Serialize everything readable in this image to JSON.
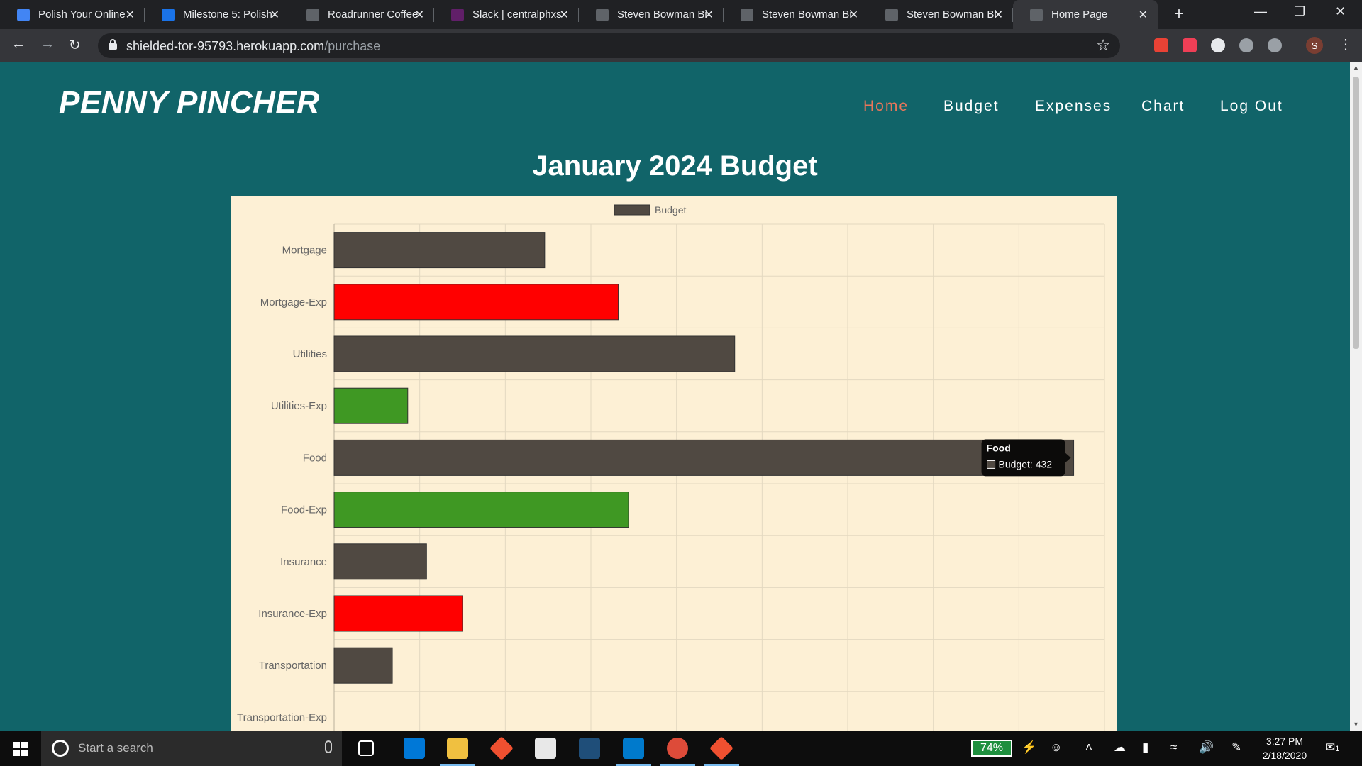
{
  "browser": {
    "tabs": [
      {
        "title": "Polish Your Online",
        "favicon": "docs-icon",
        "color": "#4285f4"
      },
      {
        "title": "Milestone 5: Polish",
        "favicon": "s-icon",
        "color": "#1a73e8"
      },
      {
        "title": "Roadrunner Coffee",
        "favicon": "globe-icon",
        "color": "#5f6368"
      },
      {
        "title": "Slack | centralphxs",
        "favicon": "slack-icon",
        "color": "#611f69"
      },
      {
        "title": "Steven Bowman Bi",
        "favicon": "globe-icon",
        "color": "#5f6368"
      },
      {
        "title": "Steven Bowman Bi",
        "favicon": "globe-icon",
        "color": "#5f6368"
      },
      {
        "title": "Steven Bowman Bi",
        "favicon": "globe-icon",
        "color": "#5f6368"
      },
      {
        "title": "Home Page",
        "favicon": "globe-icon",
        "color": "#5f6368",
        "active": true
      }
    ],
    "url_host": "shielded-tor-95793.herokuapp.com",
    "url_path": "/purchase",
    "profile_initial": "S"
  },
  "header": {
    "brand": "PENNY PINCHER",
    "nav": [
      {
        "label": "Home",
        "active": true
      },
      {
        "label": "Budget"
      },
      {
        "label": "Expenses"
      },
      {
        "label": "Chart"
      },
      {
        "label": "Log Out"
      }
    ]
  },
  "page_title": "January 2024 Budget",
  "chart_data": {
    "type": "bar",
    "orientation": "horizontal",
    "legend": [
      "Budget"
    ],
    "legend_position": "top",
    "grid": true,
    "xlim": [
      0,
      450
    ],
    "categories": [
      "Mortgage",
      "Mortgage-Exp",
      "Utilities",
      "Utilities-Exp",
      "Food",
      "Food-Exp",
      "Insurance",
      "Insurance-Exp",
      "Transportation",
      "Transportation-Exp"
    ],
    "series": [
      {
        "name": "Budget",
        "values": [
          123,
          166,
          234,
          43,
          432,
          172,
          54,
          75,
          34,
          0
        ],
        "colors": [
          "#504942",
          "#ff0000",
          "#504942",
          "#3f9823",
          "#504942",
          "#3f9823",
          "#504942",
          "#ff0000",
          "#504942",
          "#504942"
        ]
      }
    ],
    "tooltip": {
      "title": "Food",
      "label": "Budget: 432"
    }
  },
  "taskbar": {
    "search_placeholder": "Start a search",
    "battery": "74%",
    "time": "3:27 PM",
    "date": "2/18/2020",
    "notifications": "1"
  }
}
